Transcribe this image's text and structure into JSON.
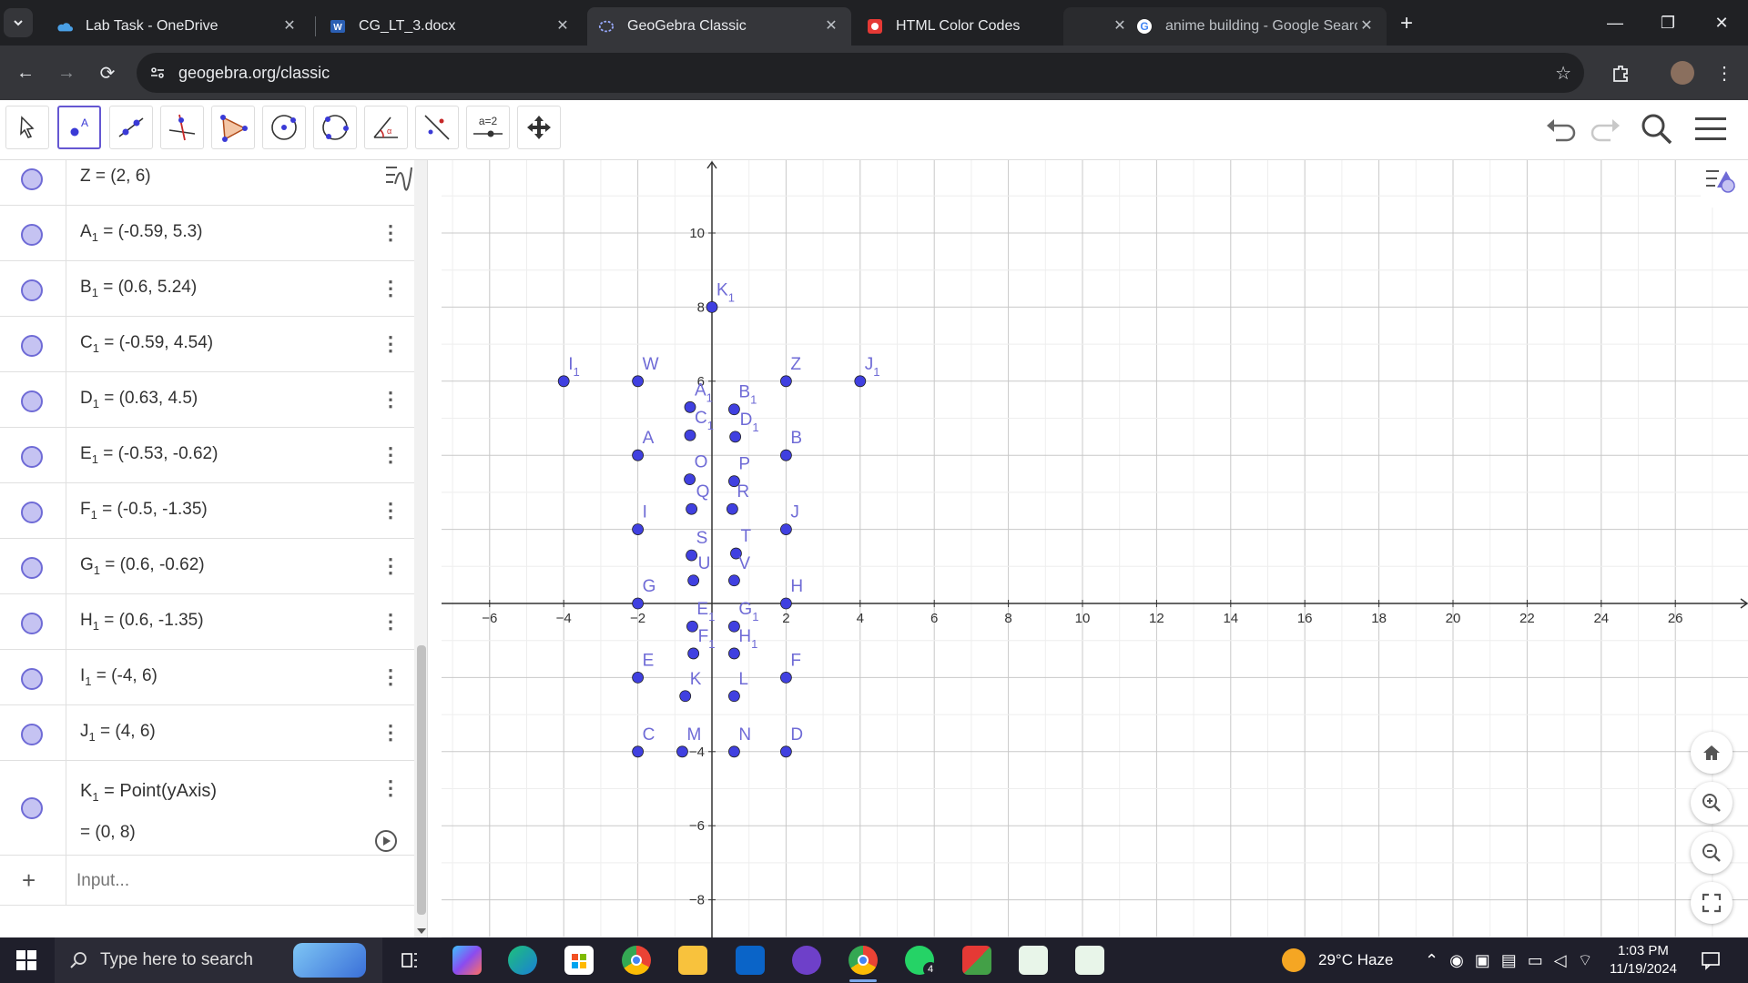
{
  "browser": {
    "tabs": [
      {
        "title": "Lab Task - OneDrive",
        "icon": "onedrive-icon",
        "color": "#4aa0e6"
      },
      {
        "title": "CG_LT_3.docx",
        "icon": "word-icon",
        "color": "#2b5fb3"
      },
      {
        "title": "GeoGebra Classic",
        "icon": "geogebra-icon",
        "color": "#99aaff",
        "active": true
      },
      {
        "title": "HTML Color Codes",
        "icon": "htmlcolor-icon",
        "color": "#e53935"
      },
      {
        "title": "anime building - Google Search",
        "icon": "google-icon",
        "color": "#ffffff"
      }
    ],
    "url": "geogebra.org/classic"
  },
  "toolbar": {
    "tools": [
      "move-tool",
      "point-tool",
      "line-tool",
      "perpendicular-tool",
      "polygon-tool",
      "circle-center-tool",
      "circle-three-points-tool",
      "angle-tool",
      "reflect-tool",
      "slider-tool",
      "move-graphics-tool"
    ],
    "slider_label": "a=2"
  },
  "algebra": {
    "rows": [
      {
        "name": "Z",
        "sub": "",
        "value": "(2, 6)"
      },
      {
        "name": "A",
        "sub": "1",
        "value": "(-0.59, 5.3)"
      },
      {
        "name": "B",
        "sub": "1",
        "value": "(0.6, 5.24)"
      },
      {
        "name": "C",
        "sub": "1",
        "value": "(-0.59, 4.54)"
      },
      {
        "name": "D",
        "sub": "1",
        "value": "(0.63, 4.5)"
      },
      {
        "name": "E",
        "sub": "1",
        "value": "(-0.53, -0.62)"
      },
      {
        "name": "F",
        "sub": "1",
        "value": "(-0.5, -1.35)"
      },
      {
        "name": "G",
        "sub": "1",
        "value": "(0.6, -0.62)"
      },
      {
        "name": "H",
        "sub": "1",
        "value": "(0.6, -1.35)"
      },
      {
        "name": "I",
        "sub": "1",
        "value": "(-4, 6)"
      },
      {
        "name": "J",
        "sub": "1",
        "value": "(4, 6)"
      }
    ],
    "k1": {
      "name": "K",
      "sub": "1",
      "definition": "Point(yAxis)",
      "value": "(0, 8)"
    },
    "input_placeholder": "Input..."
  },
  "graph": {
    "x_ticks": [
      -6,
      -4,
      -2,
      2,
      4,
      6,
      8,
      10,
      12,
      14,
      16,
      18,
      20,
      22,
      24,
      26
    ],
    "y_ticks": [
      10,
      8,
      6,
      -4,
      -6,
      -8
    ],
    "points": [
      {
        "n": "K",
        "s": "1",
        "x": 0,
        "y": 8
      },
      {
        "n": "I",
        "s": "1",
        "x": -4,
        "y": 6
      },
      {
        "n": "W",
        "s": "",
        "x": -2,
        "y": 6
      },
      {
        "n": "Z",
        "s": "",
        "x": 2,
        "y": 6
      },
      {
        "n": "J",
        "s": "1",
        "x": 4,
        "y": 6
      },
      {
        "n": "A",
        "s": "1",
        "x": -0.59,
        "y": 5.3
      },
      {
        "n": "B",
        "s": "1",
        "x": 0.6,
        "y": 5.24
      },
      {
        "n": "C",
        "s": "1",
        "x": -0.59,
        "y": 4.54
      },
      {
        "n": "D",
        "s": "1",
        "x": 0.63,
        "y": 4.5
      },
      {
        "n": "A",
        "s": "",
        "x": -2,
        "y": 4
      },
      {
        "n": "B",
        "s": "",
        "x": 2,
        "y": 4
      },
      {
        "n": "O",
        "s": "",
        "x": -0.6,
        "y": 3.35
      },
      {
        "n": "P",
        "s": "",
        "x": 0.6,
        "y": 3.3
      },
      {
        "n": "Q",
        "s": "",
        "x": -0.55,
        "y": 2.55
      },
      {
        "n": "R",
        "s": "",
        "x": 0.55,
        "y": 2.55
      },
      {
        "n": "I",
        "s": "",
        "x": -2,
        "y": 2
      },
      {
        "n": "J",
        "s": "",
        "x": 2,
        "y": 2
      },
      {
        "n": "S",
        "s": "",
        "x": -0.55,
        "y": 1.3
      },
      {
        "n": "T",
        "s": "",
        "x": 0.65,
        "y": 1.35
      },
      {
        "n": "U",
        "s": "",
        "x": -0.5,
        "y": 0.62
      },
      {
        "n": "V",
        "s": "",
        "x": 0.6,
        "y": 0.62
      },
      {
        "n": "G",
        "s": "",
        "x": -2,
        "y": 0
      },
      {
        "n": "H",
        "s": "",
        "x": 2,
        "y": 0
      },
      {
        "n": "E",
        "s": "1",
        "x": -0.53,
        "y": -0.62
      },
      {
        "n": "G",
        "s": "1",
        "x": 0.6,
        "y": -0.62
      },
      {
        "n": "F",
        "s": "1",
        "x": -0.5,
        "y": -1.35
      },
      {
        "n": "H",
        "s": "1",
        "x": 0.6,
        "y": -1.35
      },
      {
        "n": "E",
        "s": "",
        "x": -2,
        "y": -2
      },
      {
        "n": "F",
        "s": "",
        "x": 2,
        "y": -2
      },
      {
        "n": "K",
        "s": "",
        "x": -0.72,
        "y": -2.5
      },
      {
        "n": "L",
        "s": "",
        "x": 0.6,
        "y": -2.5
      },
      {
        "n": "C",
        "s": "",
        "x": -2,
        "y": -4
      },
      {
        "n": "M",
        "s": "",
        "x": -0.8,
        "y": -4
      },
      {
        "n": "N",
        "s": "",
        "x": 0.6,
        "y": -4
      },
      {
        "n": "D",
        "s": "",
        "x": 2,
        "y": -4
      }
    ]
  },
  "taskbar": {
    "search_placeholder": "Type here to search",
    "weather": "29°C  Haze",
    "time": "1:03 PM",
    "date": "11/19/2024",
    "whatsapp_badge": "4"
  },
  "colors": {
    "point": "#4040e0",
    "label": "#6f6bd6",
    "grid_minor": "#eeeeee",
    "grid_major": "#c8c8c8"
  }
}
